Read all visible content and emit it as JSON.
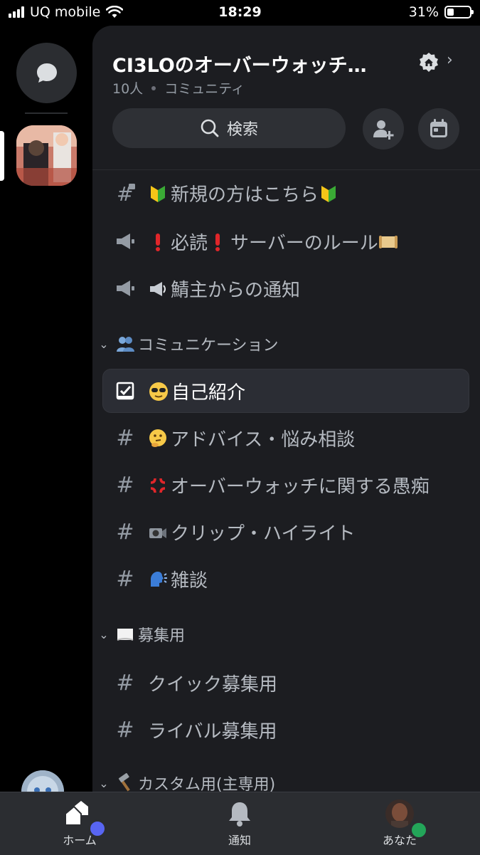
{
  "status_bar": {
    "carrier": "UQ mobile",
    "time": "18:29",
    "battery_percent": "31%",
    "battery_level": 0.31
  },
  "server": {
    "name": "CI3LOのオーバーウォッチ…",
    "member_count": "10人",
    "type": "コミュニティ"
  },
  "search": {
    "label": "検索"
  },
  "channels_top": [
    {
      "icon": "locked-hash-icon",
      "emoji": "beginner",
      "label": "新規の方はこちら",
      "emoji_after": "beginner"
    },
    {
      "icon": "announcement-icon",
      "emoji": "exclamation",
      "label": "必読",
      "emoji_mid": "exclamation",
      "label2": "サーバーのルール",
      "emoji_after": "scroll"
    },
    {
      "icon": "announcement-icon",
      "emoji": "loudspeaker",
      "label": "鯖主からの通知"
    }
  ],
  "categories": [
    {
      "emoji": "people",
      "name": "コミュニケーション",
      "channels": [
        {
          "icon": "rules-check-icon",
          "emoji": "sunglasses",
          "label": "自己紹介",
          "selected": true
        },
        {
          "icon": "hash-icon",
          "emoji": "thinking",
          "label": "アドバイス・悩み相談"
        },
        {
          "icon": "hash-icon",
          "emoji": "anger",
          "label": "オーバーウォッチに関する愚痴"
        },
        {
          "icon": "hash-icon",
          "emoji": "camera",
          "label": "クリップ・ハイライト"
        },
        {
          "icon": "hash-icon",
          "emoji": "speaking",
          "label": "雑談"
        }
      ]
    },
    {
      "emoji": "page",
      "name": "募集用",
      "channels": [
        {
          "icon": "hash-icon",
          "label": "クイック募集用"
        },
        {
          "icon": "hash-icon",
          "label": "ライバル募集用"
        }
      ]
    },
    {
      "emoji": "hammer",
      "name": "カスタム用(主専用)"
    }
  ],
  "bottom_nav": [
    {
      "label": "ホーム",
      "icon": "home-icon"
    },
    {
      "label": "通知",
      "icon": "bell-icon"
    },
    {
      "label": "あなた",
      "icon": "avatar"
    }
  ],
  "colors": {
    "background": "#1c1d21",
    "rail": "#000000",
    "accent_blurple": "#5865f2",
    "online_green": "#23a559",
    "selected_row": "#2b2d34"
  }
}
